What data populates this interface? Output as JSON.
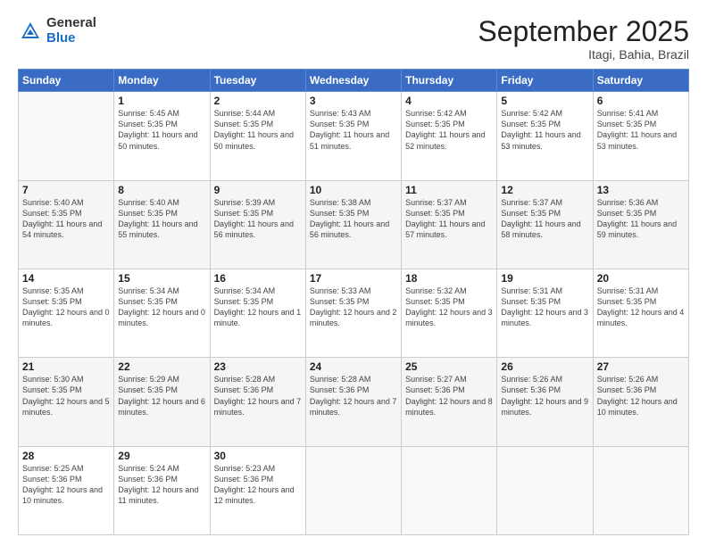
{
  "logo": {
    "general": "General",
    "blue": "Blue"
  },
  "header": {
    "month": "September 2025",
    "location": "Itagi, Bahia, Brazil"
  },
  "days_of_week": [
    "Sunday",
    "Monday",
    "Tuesday",
    "Wednesday",
    "Thursday",
    "Friday",
    "Saturday"
  ],
  "weeks": [
    [
      {
        "day": "",
        "sunrise": "",
        "sunset": "",
        "daylight": ""
      },
      {
        "day": "1",
        "sunrise": "Sunrise: 5:45 AM",
        "sunset": "Sunset: 5:35 PM",
        "daylight": "Daylight: 11 hours and 50 minutes."
      },
      {
        "day": "2",
        "sunrise": "Sunrise: 5:44 AM",
        "sunset": "Sunset: 5:35 PM",
        "daylight": "Daylight: 11 hours and 50 minutes."
      },
      {
        "day": "3",
        "sunrise": "Sunrise: 5:43 AM",
        "sunset": "Sunset: 5:35 PM",
        "daylight": "Daylight: 11 hours and 51 minutes."
      },
      {
        "day": "4",
        "sunrise": "Sunrise: 5:42 AM",
        "sunset": "Sunset: 5:35 PM",
        "daylight": "Daylight: 11 hours and 52 minutes."
      },
      {
        "day": "5",
        "sunrise": "Sunrise: 5:42 AM",
        "sunset": "Sunset: 5:35 PM",
        "daylight": "Daylight: 11 hours and 53 minutes."
      },
      {
        "day": "6",
        "sunrise": "Sunrise: 5:41 AM",
        "sunset": "Sunset: 5:35 PM",
        "daylight": "Daylight: 11 hours and 53 minutes."
      }
    ],
    [
      {
        "day": "7",
        "sunrise": "Sunrise: 5:40 AM",
        "sunset": "Sunset: 5:35 PM",
        "daylight": "Daylight: 11 hours and 54 minutes."
      },
      {
        "day": "8",
        "sunrise": "Sunrise: 5:40 AM",
        "sunset": "Sunset: 5:35 PM",
        "daylight": "Daylight: 11 hours and 55 minutes."
      },
      {
        "day": "9",
        "sunrise": "Sunrise: 5:39 AM",
        "sunset": "Sunset: 5:35 PM",
        "daylight": "Daylight: 11 hours and 56 minutes."
      },
      {
        "day": "10",
        "sunrise": "Sunrise: 5:38 AM",
        "sunset": "Sunset: 5:35 PM",
        "daylight": "Daylight: 11 hours and 56 minutes."
      },
      {
        "day": "11",
        "sunrise": "Sunrise: 5:37 AM",
        "sunset": "Sunset: 5:35 PM",
        "daylight": "Daylight: 11 hours and 57 minutes."
      },
      {
        "day": "12",
        "sunrise": "Sunrise: 5:37 AM",
        "sunset": "Sunset: 5:35 PM",
        "daylight": "Daylight: 11 hours and 58 minutes."
      },
      {
        "day": "13",
        "sunrise": "Sunrise: 5:36 AM",
        "sunset": "Sunset: 5:35 PM",
        "daylight": "Daylight: 11 hours and 59 minutes."
      }
    ],
    [
      {
        "day": "14",
        "sunrise": "Sunrise: 5:35 AM",
        "sunset": "Sunset: 5:35 PM",
        "daylight": "Daylight: 12 hours and 0 minutes."
      },
      {
        "day": "15",
        "sunrise": "Sunrise: 5:34 AM",
        "sunset": "Sunset: 5:35 PM",
        "daylight": "Daylight: 12 hours and 0 minutes."
      },
      {
        "day": "16",
        "sunrise": "Sunrise: 5:34 AM",
        "sunset": "Sunset: 5:35 PM",
        "daylight": "Daylight: 12 hours and 1 minute."
      },
      {
        "day": "17",
        "sunrise": "Sunrise: 5:33 AM",
        "sunset": "Sunset: 5:35 PM",
        "daylight": "Daylight: 12 hours and 2 minutes."
      },
      {
        "day": "18",
        "sunrise": "Sunrise: 5:32 AM",
        "sunset": "Sunset: 5:35 PM",
        "daylight": "Daylight: 12 hours and 3 minutes."
      },
      {
        "day": "19",
        "sunrise": "Sunrise: 5:31 AM",
        "sunset": "Sunset: 5:35 PM",
        "daylight": "Daylight: 12 hours and 3 minutes."
      },
      {
        "day": "20",
        "sunrise": "Sunrise: 5:31 AM",
        "sunset": "Sunset: 5:35 PM",
        "daylight": "Daylight: 12 hours and 4 minutes."
      }
    ],
    [
      {
        "day": "21",
        "sunrise": "Sunrise: 5:30 AM",
        "sunset": "Sunset: 5:35 PM",
        "daylight": "Daylight: 12 hours and 5 minutes."
      },
      {
        "day": "22",
        "sunrise": "Sunrise: 5:29 AM",
        "sunset": "Sunset: 5:35 PM",
        "daylight": "Daylight: 12 hours and 6 minutes."
      },
      {
        "day": "23",
        "sunrise": "Sunrise: 5:28 AM",
        "sunset": "Sunset: 5:36 PM",
        "daylight": "Daylight: 12 hours and 7 minutes."
      },
      {
        "day": "24",
        "sunrise": "Sunrise: 5:28 AM",
        "sunset": "Sunset: 5:36 PM",
        "daylight": "Daylight: 12 hours and 7 minutes."
      },
      {
        "day": "25",
        "sunrise": "Sunrise: 5:27 AM",
        "sunset": "Sunset: 5:36 PM",
        "daylight": "Daylight: 12 hours and 8 minutes."
      },
      {
        "day": "26",
        "sunrise": "Sunrise: 5:26 AM",
        "sunset": "Sunset: 5:36 PM",
        "daylight": "Daylight: 12 hours and 9 minutes."
      },
      {
        "day": "27",
        "sunrise": "Sunrise: 5:26 AM",
        "sunset": "Sunset: 5:36 PM",
        "daylight": "Daylight: 12 hours and 10 minutes."
      }
    ],
    [
      {
        "day": "28",
        "sunrise": "Sunrise: 5:25 AM",
        "sunset": "Sunset: 5:36 PM",
        "daylight": "Daylight: 12 hours and 10 minutes."
      },
      {
        "day": "29",
        "sunrise": "Sunrise: 5:24 AM",
        "sunset": "Sunset: 5:36 PM",
        "daylight": "Daylight: 12 hours and 11 minutes."
      },
      {
        "day": "30",
        "sunrise": "Sunrise: 5:23 AM",
        "sunset": "Sunset: 5:36 PM",
        "daylight": "Daylight: 12 hours and 12 minutes."
      },
      {
        "day": "",
        "sunrise": "",
        "sunset": "",
        "daylight": ""
      },
      {
        "day": "",
        "sunrise": "",
        "sunset": "",
        "daylight": ""
      },
      {
        "day": "",
        "sunrise": "",
        "sunset": "",
        "daylight": ""
      },
      {
        "day": "",
        "sunrise": "",
        "sunset": "",
        "daylight": ""
      }
    ]
  ]
}
